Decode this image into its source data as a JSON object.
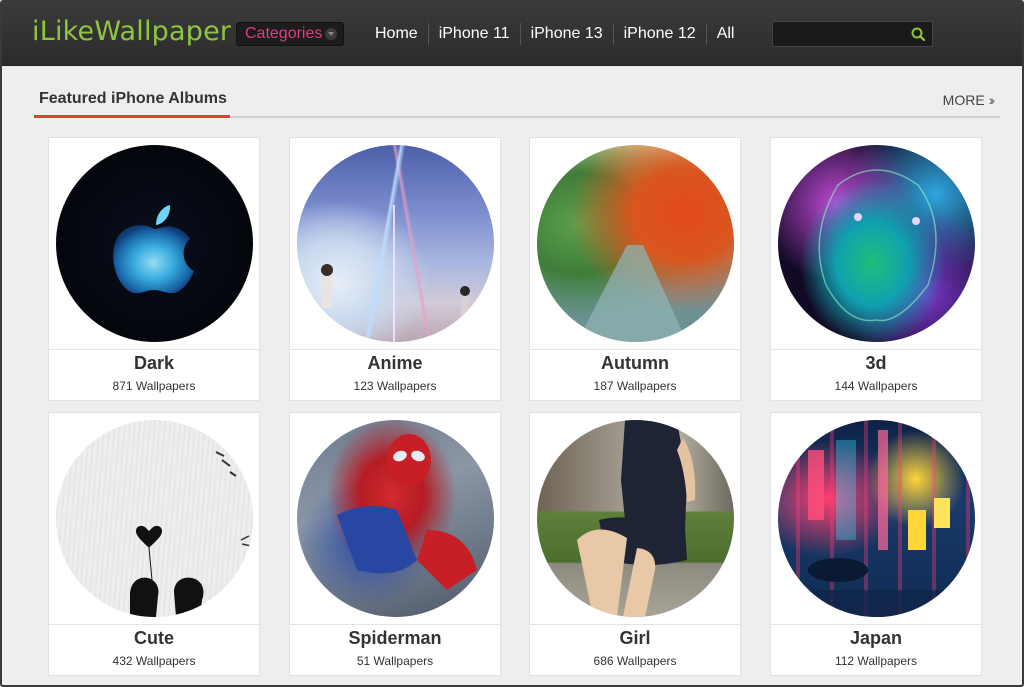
{
  "header": {
    "logo": "iLikeWallpaper",
    "categories_label": "Categories",
    "nav": [
      "Home",
      "iPhone 11",
      "iPhone 13",
      "iPhone 12",
      "All"
    ],
    "search_placeholder": ""
  },
  "section": {
    "title": "Featured iPhone Albums",
    "more_label": "MORE",
    "accent_color": "#d9432c"
  },
  "albums": [
    {
      "name": "Dark",
      "count": "871 Wallpapers"
    },
    {
      "name": "Anime",
      "count": "123 Wallpapers"
    },
    {
      "name": "Autumn",
      "count": "187 Wallpapers"
    },
    {
      "name": "3d",
      "count": "144 Wallpapers"
    },
    {
      "name": "Cute",
      "count": "432 Wallpapers"
    },
    {
      "name": "Spiderman",
      "count": "51 Wallpapers"
    },
    {
      "name": "Girl",
      "count": "686 Wallpapers"
    },
    {
      "name": "Japan",
      "count": "112 Wallpapers"
    }
  ],
  "colors": {
    "logo": "#8ec63f",
    "categories": "#e23a83",
    "header_bg": "#333333"
  }
}
